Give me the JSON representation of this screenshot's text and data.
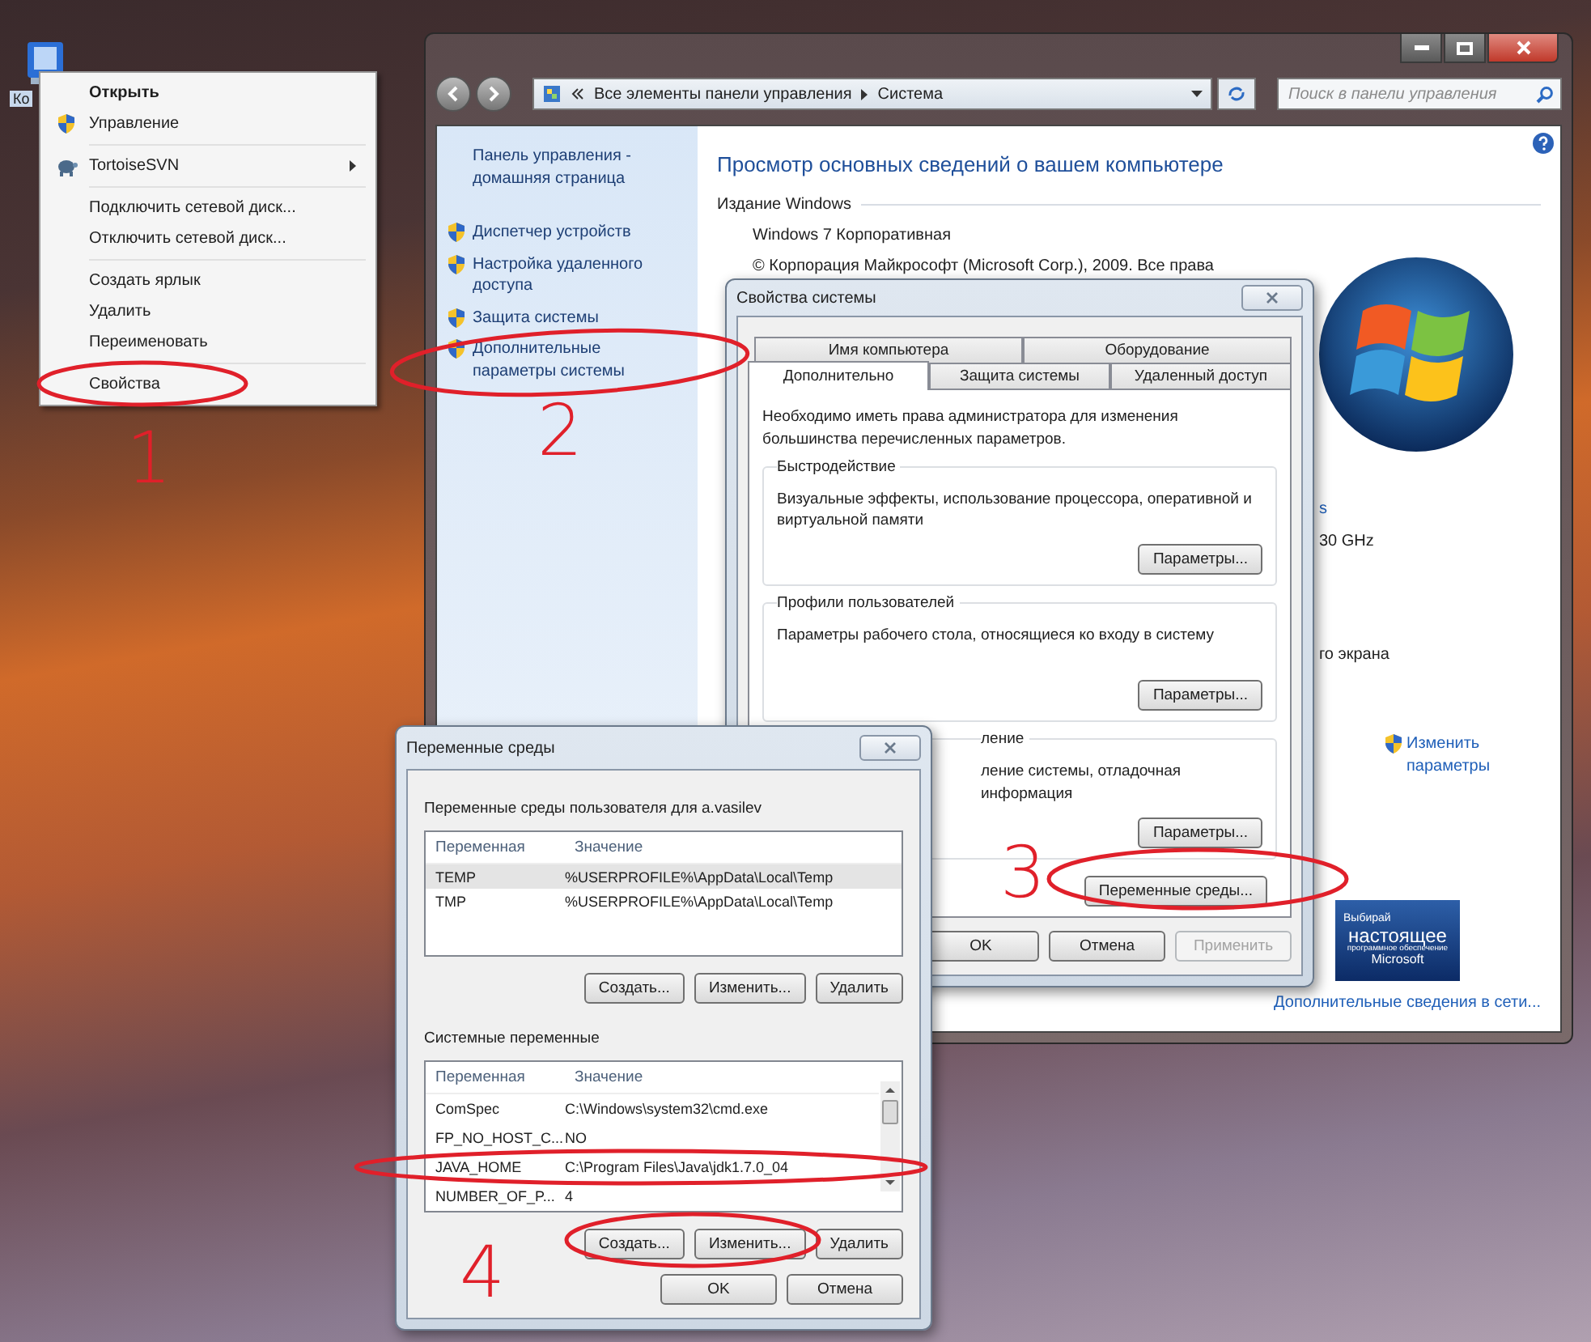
{
  "desktop": {
    "icon_label": "Ко"
  },
  "context_menu": {
    "groups": [
      [
        {
          "label": "Открыть",
          "default": true,
          "submenu": false
        },
        {
          "label": "Управление",
          "default": false,
          "submenu": false
        }
      ],
      [
        {
          "label": "TortoiseSVN",
          "default": false,
          "submenu": true
        }
      ],
      [
        {
          "label": "Подключить сетевой диск...",
          "default": false,
          "submenu": false
        },
        {
          "label": "Отключить сетевой диск...",
          "default": false,
          "submenu": false
        }
      ],
      [
        {
          "label": "Создать ярлык",
          "default": false,
          "submenu": false
        },
        {
          "label": "Удалить",
          "default": false,
          "submenu": false
        },
        {
          "label": "Переименовать",
          "default": false,
          "submenu": false
        }
      ],
      [
        {
          "label": "Свойства",
          "default": false,
          "submenu": false
        }
      ]
    ]
  },
  "system_window": {
    "address": {
      "path": [
        "Все элементы панели управления",
        "Система"
      ]
    },
    "search": {
      "placeholder": "Поиск в панели управления"
    },
    "sidebar": {
      "home": "Панель управления - домашняя страница",
      "links": [
        "Диспетчер устройств",
        "Настройка удаленного доступа",
        "Защита системы",
        "Дополнительные параметры системы"
      ]
    },
    "heading": "Просмотр основных сведений о вашем компьютере",
    "edition_label": "Издание Windows",
    "edition_lines": [
      "Windows 7 Корпоративная",
      "© Корпорация Майкрософт (Microsoft Corp.), 2009. Все права"
    ],
    "fragments": [
      {
        "text": "s",
        "kind": "link"
      },
      {
        "text": "30 GHz",
        "kind": "text"
      },
      {
        "text": "го экрана",
        "kind": "text"
      }
    ],
    "change_link": "Изменить параметры",
    "badge": {
      "lines": [
        "Выбирай",
        "настоящее",
        "программное обеспечение",
        "Microsoft"
      ]
    },
    "more_link": "Дополнительные сведения в сети..."
  },
  "properties_dialog": {
    "title": "Свойства системы",
    "tab_rows": [
      [
        {
          "label": "Имя компьютера",
          "selected": false
        },
        {
          "label": "Оборудование",
          "selected": false
        }
      ],
      [
        {
          "label": "Дополнительно",
          "selected": true
        },
        {
          "label": "Защита системы",
          "selected": false
        },
        {
          "label": "Удаленный доступ",
          "selected": false
        }
      ]
    ],
    "note": "Необходимо иметь права администратора для изменения большинства перечисленных параметров.",
    "groups": [
      {
        "title": "Быстродействие",
        "text": "Визуальные эффекты, использование процессора, оперативной и виртуальной памяти",
        "button": "Параметры...",
        "kind": "full"
      },
      {
        "title": "Профили пользователей",
        "text": "Параметры рабочего стола, относящиеся ко входу в систему",
        "button": "Параметры...",
        "kind": "full"
      },
      {
        "title": "ление",
        "text": "ление системы, отладочная информация",
        "button": "Параметры...",
        "kind": "clipped"
      }
    ],
    "env_button": "Переменные среды...",
    "footer": [
      {
        "label": "OK",
        "disabled": false
      },
      {
        "label": "Отмена",
        "disabled": false
      },
      {
        "label": "Применить",
        "disabled": true
      }
    ]
  },
  "env_dialog": {
    "title": "Переменные среды",
    "user_label": "Переменные среды пользователя для a.vasilev",
    "columns": [
      "Переменная",
      "Значение"
    ],
    "user_rows": [
      {
        "name": "TEMP",
        "value": "%USERPROFILE%\\AppData\\Local\\Temp",
        "selected": true
      },
      {
        "name": "TMP",
        "value": "%USERPROFILE%\\AppData\\Local\\Temp",
        "selected": false
      }
    ],
    "user_buttons": [
      "Создать...",
      "Изменить...",
      "Удалить"
    ],
    "system_label": "Системные переменные",
    "system_columns": [
      "Переменная",
      "Значение"
    ],
    "system_rows": [
      {
        "name": "ComSpec",
        "value": "C:\\Windows\\system32\\cmd.exe",
        "selected": false
      },
      {
        "name": "FP_NO_HOST_C...",
        "value": "NO",
        "selected": false
      },
      {
        "name": "JAVA_HOME",
        "value": "C:\\Program Files\\Java\\jdk1.7.0_04",
        "selected": false
      },
      {
        "name": "NUMBER_OF_P...",
        "value": "4",
        "selected": false
      }
    ],
    "system_buttons": [
      "Создать...",
      "Изменить...",
      "Удалить"
    ],
    "footer": [
      "OK",
      "Отмена"
    ]
  },
  "annotations": [
    {
      "label": "1"
    },
    {
      "label": "2"
    },
    {
      "label": "3"
    },
    {
      "label": "4"
    }
  ]
}
